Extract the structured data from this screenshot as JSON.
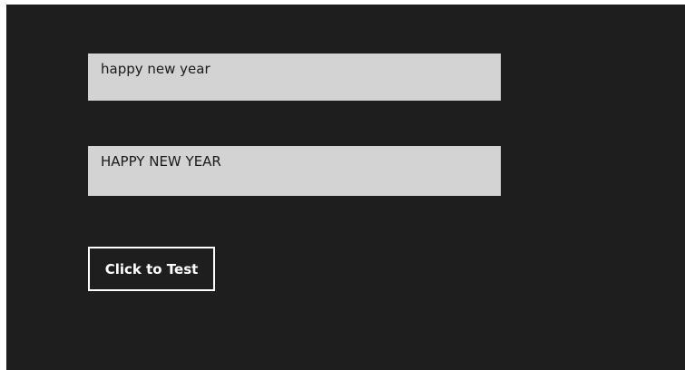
{
  "input_box": {
    "value": "happy new year"
  },
  "output_box": {
    "value": "HAPPY NEW YEAR"
  },
  "test_button": {
    "label": "Click to Test"
  },
  "colors": {
    "background": "#1e1e1e",
    "textbox_background": "#d3d3d3",
    "button_border": "#ffffff"
  }
}
